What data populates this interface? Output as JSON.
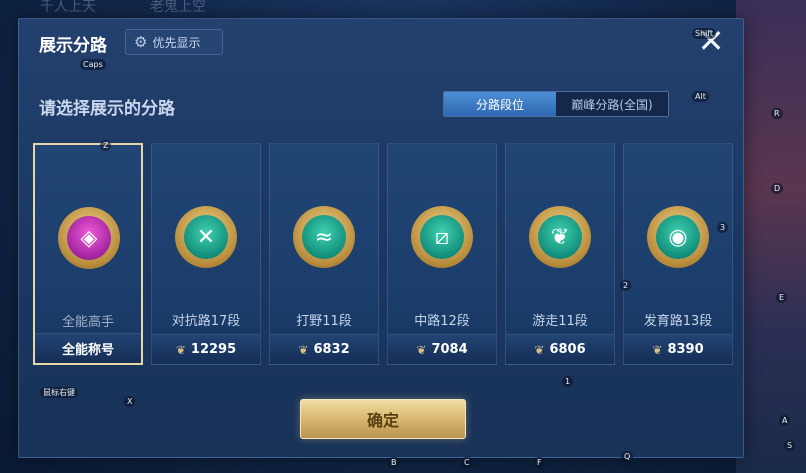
{
  "background": {
    "tabs": [
      "千人上天",
      "老鬼上空"
    ]
  },
  "header": {
    "title": "展示分路",
    "priority_label": "优先显示",
    "close_icon": "close-icon"
  },
  "subtitle": "请选择展示的分路",
  "segment": {
    "items": [
      {
        "label": "分路段位",
        "active": true
      },
      {
        "label": "巅峰分路(全国)",
        "active": false
      }
    ]
  },
  "cards": [
    {
      "label": "全能高手",
      "value": "全能称号",
      "icon": "all-round-emblem-icon",
      "color": "purple",
      "selected": true,
      "glyph": "◈"
    },
    {
      "label": "对抗路17段",
      "value": "12295",
      "icon": "clash-lane-emblem-icon",
      "color": "green",
      "selected": false,
      "glyph": "✕"
    },
    {
      "label": "打野11段",
      "value": "6832",
      "icon": "jungle-emblem-icon",
      "color": "green",
      "selected": false,
      "glyph": "≈"
    },
    {
      "label": "中路12段",
      "value": "7084",
      "icon": "mid-lane-emblem-icon",
      "color": "green",
      "selected": false,
      "glyph": "⧄"
    },
    {
      "label": "游走11段",
      "value": "6806",
      "icon": "roam-emblem-icon",
      "color": "green",
      "selected": false,
      "glyph": "❦"
    },
    {
      "label": "发育路13段",
      "value": "8390",
      "icon": "farm-lane-emblem-icon",
      "color": "green",
      "selected": false,
      "glyph": "◉"
    }
  ],
  "confirm_label": "确定",
  "key_hints": [
    "Shift",
    "Caps",
    "Alt",
    "Z",
    "R",
    "D",
    "3",
    "2",
    "E",
    "1",
    "X",
    "鼠标右键",
    "A",
    "S",
    "B",
    "C",
    "F",
    "Q"
  ],
  "colors": {
    "panel": "#1c3863",
    "accent": "#4d8fd6",
    "gold": "#d8b870"
  }
}
